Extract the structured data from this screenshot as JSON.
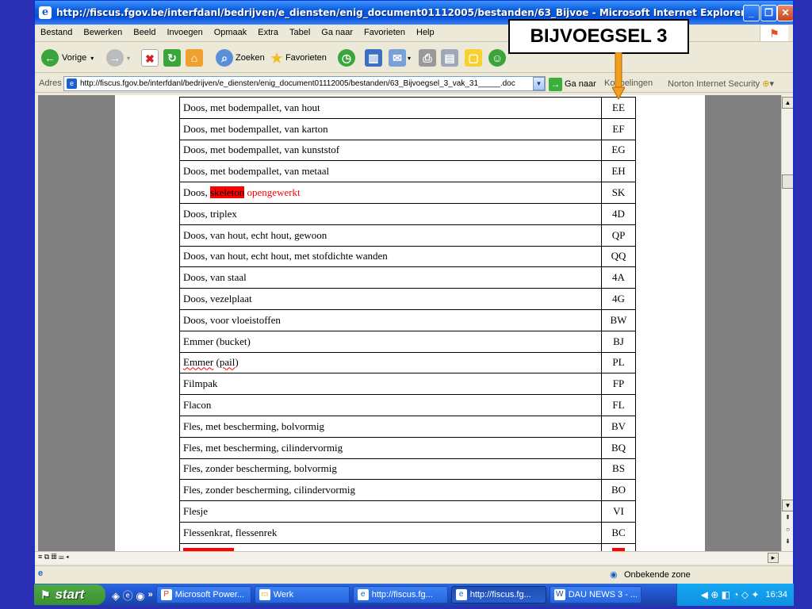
{
  "window": {
    "title": "http://fiscus.fgov.be/interfdanl/bedrijven/e_diensten/enig_document01112005/bestanden/63_Bijvoe - Microsoft Internet Explorer"
  },
  "menu": [
    "Bestand",
    "Bewerken",
    "Beeld",
    "Invoegen",
    "Opmaak",
    "Extra",
    "Tabel",
    "Ga naar",
    "Favorieten",
    "Help"
  ],
  "toolbar": {
    "back_label": "Vorige",
    "search_label": "Zoeken",
    "favorites_label": "Favorieten"
  },
  "address": {
    "label": "Adres",
    "url": "http://fiscus.fgov.be/interfdanl/bedrijven/e_diensten/enig_document01112005/bestanden/63_Bijvoegsel_3_vak_31_____.doc",
    "go_label": "Ga naar",
    "links_label": "Koppelingen",
    "norton_label": "Norton Internet Security"
  },
  "callout": {
    "label": "BIJVOEGSEL 3"
  },
  "table_rows": [
    {
      "desc": "Doos, met bodempallet, van hout",
      "code": "EE"
    },
    {
      "desc": "Doos, met bodempallet, van karton",
      "code": "EF"
    },
    {
      "desc": "Doos, met bodempallet, van kunststof",
      "code": "EG"
    },
    {
      "desc": "Doos, met bodempallet, van metaal",
      "code": "EH"
    },
    {
      "desc_parts": [
        "Doos, ",
        "skeleton",
        " opengewerkt"
      ],
      "code": "SK"
    },
    {
      "desc": "Doos, triplex",
      "code": "4D"
    },
    {
      "desc": "Doos, van hout, echt hout, gewoon",
      "code": "QP"
    },
    {
      "desc": "Doos, van hout, echt hout, met stofdichte wanden",
      "code": "QQ"
    },
    {
      "desc": "Doos, van staal",
      "code": "4A"
    },
    {
      "desc": "Doos, vezelplaat",
      "code": "4G"
    },
    {
      "desc": "Doos, voor vloeistoffen",
      "code": "BW"
    },
    {
      "desc": "Emmer (bucket)",
      "code": "BJ"
    },
    {
      "desc_parts": [
        "Emmer",
        " (",
        "pail",
        ")"
      ],
      "code": "PL"
    },
    {
      "desc": "Filmpak",
      "code": "FP"
    },
    {
      "desc": "Flacon",
      "code": "FL"
    },
    {
      "desc": "Fles, met bescherming, bolvormig",
      "code": "BV"
    },
    {
      "desc": "Fles, met bescherming, cilindervormig",
      "code": "BQ"
    },
    {
      "desc": "Fles, zonder bescherming, bolvormig",
      "code": "BS"
    },
    {
      "desc": "Fles, zonder bescherming, cilindervormig",
      "code": "BO"
    },
    {
      "desc": "Flesje",
      "code": "VI"
    },
    {
      "desc": "Flessenkrat, flessenrek",
      "code": "BC"
    }
  ],
  "status": {
    "zone_label": "Onbekende zone"
  },
  "taskbar": {
    "start_label": "start",
    "tasks": [
      "Microsoft Power...",
      "Werk",
      "http://fiscus.fg...",
      "http://fiscus.fg...",
      "DAU NEWS 3 - ..."
    ],
    "clock": "16:34"
  }
}
